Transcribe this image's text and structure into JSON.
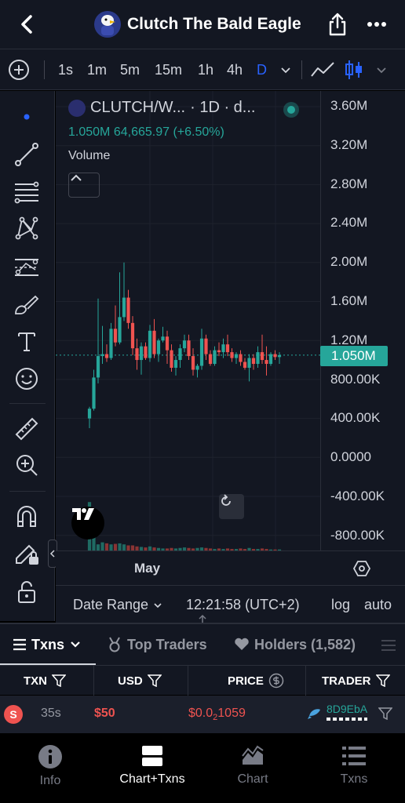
{
  "header": {
    "title": "Clutch The Bald Eagle",
    "back_icon": "chevron-left-icon",
    "share_icon": "share-icon",
    "more_icon": "more-horizontal-icon"
  },
  "toolbar": {
    "intervals": [
      "1s",
      "1m",
      "5m",
      "15m",
      "1h",
      "4h",
      "D"
    ],
    "active_interval": "D"
  },
  "chart": {
    "symbol": "CLUTCH/W...",
    "meta": "· 1D · d...",
    "last_value": "1.050M",
    "change_value": "64,665.97",
    "change_pct": "(+6.50%)",
    "volume_label": "Volume",
    "price_tag": "1.050M",
    "y_labels": [
      "3.60M",
      "3.20M",
      "2.80M",
      "2.40M",
      "2.00M",
      "1.60M",
      "1.20M",
      "800.00K",
      "400.00K",
      "0.0000",
      "-400.00K",
      "-800.00K"
    ],
    "x_label": "May",
    "up_color": "#26a69a",
    "down_color": "#ef5350"
  },
  "chart_data": {
    "type": "candlestick",
    "ylim": [
      -900000,
      3700000
    ],
    "y_ticks": [
      3600000,
      3200000,
      2800000,
      2400000,
      2000000,
      1600000,
      1200000,
      800000,
      400000,
      0,
      -400000,
      -800000
    ],
    "x_tick_labels": [
      "May"
    ],
    "last_price": 1050000,
    "candles": [
      {
        "o": 400000,
        "h": 520000,
        "l": 300000,
        "c": 500000
      },
      {
        "o": 500000,
        "h": 900000,
        "l": 480000,
        "c": 820000
      },
      {
        "o": 820000,
        "h": 1630000,
        "l": 760000,
        "c": 1040000
      },
      {
        "o": 1040000,
        "h": 1350000,
        "l": 960000,
        "c": 1060000
      },
      {
        "o": 1060000,
        "h": 1160000,
        "l": 980000,
        "c": 1020000
      },
      {
        "o": 1020000,
        "h": 1380000,
        "l": 1000000,
        "c": 1320000
      },
      {
        "o": 1320000,
        "h": 1560000,
        "l": 1140000,
        "c": 1180000
      },
      {
        "o": 1180000,
        "h": 1900000,
        "l": 1160000,
        "c": 1440000
      },
      {
        "o": 1440000,
        "h": 2000000,
        "l": 1400000,
        "c": 1640000
      },
      {
        "o": 1640000,
        "h": 1720000,
        "l": 1320000,
        "c": 1380000
      },
      {
        "o": 1380000,
        "h": 1450000,
        "l": 1050000,
        "c": 1120000
      },
      {
        "o": 1120000,
        "h": 1220000,
        "l": 900000,
        "c": 1000000
      },
      {
        "o": 1000000,
        "h": 1180000,
        "l": 850000,
        "c": 1140000
      },
      {
        "o": 1140000,
        "h": 1180000,
        "l": 1000000,
        "c": 1020000
      },
      {
        "o": 1020000,
        "h": 1360000,
        "l": 980000,
        "c": 1300000
      },
      {
        "o": 1300000,
        "h": 1420000,
        "l": 1020000,
        "c": 1060000
      },
      {
        "o": 1060000,
        "h": 1220000,
        "l": 980000,
        "c": 1200000
      },
      {
        "o": 1200000,
        "h": 1340000,
        "l": 1180000,
        "c": 1240000
      },
      {
        "o": 1240000,
        "h": 1300000,
        "l": 960000,
        "c": 1100000
      },
      {
        "o": 1100000,
        "h": 1160000,
        "l": 880000,
        "c": 920000
      },
      {
        "o": 920000,
        "h": 1040000,
        "l": 840000,
        "c": 1000000
      },
      {
        "o": 1000000,
        "h": 1160000,
        "l": 920000,
        "c": 1120000
      },
      {
        "o": 1120000,
        "h": 1260000,
        "l": 1080000,
        "c": 1200000
      },
      {
        "o": 1200000,
        "h": 1260000,
        "l": 1000000,
        "c": 1040000
      },
      {
        "o": 1040000,
        "h": 1120000,
        "l": 840000,
        "c": 900000
      },
      {
        "o": 900000,
        "h": 960000,
        "l": 820000,
        "c": 940000
      },
      {
        "o": 940000,
        "h": 1320000,
        "l": 900000,
        "c": 1220000
      },
      {
        "o": 1220000,
        "h": 1260000,
        "l": 1000000,
        "c": 1060000
      },
      {
        "o": 1060000,
        "h": 1100000,
        "l": 940000,
        "c": 960000
      },
      {
        "o": 960000,
        "h": 1140000,
        "l": 940000,
        "c": 1100000
      },
      {
        "o": 1100000,
        "h": 1180000,
        "l": 1040000,
        "c": 1080000
      },
      {
        "o": 1080000,
        "h": 1220000,
        "l": 1020000,
        "c": 1160000
      },
      {
        "o": 1160000,
        "h": 1260000,
        "l": 1040000,
        "c": 1080000
      },
      {
        "o": 1080000,
        "h": 1120000,
        "l": 980000,
        "c": 1020000
      },
      {
        "o": 1020000,
        "h": 1080000,
        "l": 960000,
        "c": 1060000
      },
      {
        "o": 1060000,
        "h": 1100000,
        "l": 940000,
        "c": 980000
      },
      {
        "o": 980000,
        "h": 1020000,
        "l": 900000,
        "c": 920000
      },
      {
        "o": 920000,
        "h": 1060000,
        "l": 780000,
        "c": 1020000
      },
      {
        "o": 1020000,
        "h": 1060000,
        "l": 900000,
        "c": 960000
      },
      {
        "o": 960000,
        "h": 1140000,
        "l": 920000,
        "c": 1080000
      },
      {
        "o": 1080000,
        "h": 1260000,
        "l": 960000,
        "c": 1000000
      },
      {
        "o": 1000000,
        "h": 1140000,
        "l": 840000,
        "c": 960000
      },
      {
        "o": 960000,
        "h": 1080000,
        "l": 940000,
        "c": 1060000
      },
      {
        "o": 1060000,
        "h": 1100000,
        "l": 1000000,
        "c": 1030000
      },
      {
        "o": 1030000,
        "h": 1080000,
        "l": 960000,
        "c": 1050000
      }
    ],
    "volume": [
      0.95,
      0.35,
      0.12,
      0.16,
      0.14,
      0.12,
      0.13,
      0.14,
      0.12,
      0.1,
      0.1,
      0.08,
      0.07,
      0.06,
      0.08,
      0.06,
      0.05,
      0.04,
      0.04,
      0.05,
      0.04,
      0.05,
      0.06,
      0.05,
      0.04,
      0.05,
      0.06,
      0.05,
      0.04,
      0.03,
      0.04,
      0.03,
      0.04,
      0.03,
      0.03,
      0.04,
      0.03,
      0.05,
      0.03,
      0.03,
      0.04,
      0.03,
      0.02,
      0.02,
      0.02
    ]
  },
  "chart_footer": {
    "date_range": "Date Range",
    "time": "12:21:58 (UTC+2)",
    "log": "log",
    "auto": "auto"
  },
  "tabs": [
    {
      "label": "Txns",
      "active": true
    },
    {
      "label": "Top Traders",
      "active": false
    },
    {
      "label": "Holders (1,582)",
      "active": false
    }
  ],
  "table": {
    "headers": [
      "TXN",
      "USD",
      "PRICE",
      "TRADER"
    ],
    "rows": [
      {
        "type": "S",
        "age": "35s",
        "usd": "$50",
        "price_main": "$0.0",
        "price_sub": "2",
        "price_tail": "1059",
        "trader": "8D9EbA"
      }
    ]
  },
  "bottom_nav": [
    {
      "label": "Info",
      "icon": "info-icon",
      "active": false
    },
    {
      "label": "Chart+Txns",
      "icon": "chart-txns-icon",
      "active": true
    },
    {
      "label": "Chart",
      "icon": "chart-icon",
      "active": false
    },
    {
      "label": "Txns",
      "icon": "list-icon",
      "active": false
    }
  ]
}
